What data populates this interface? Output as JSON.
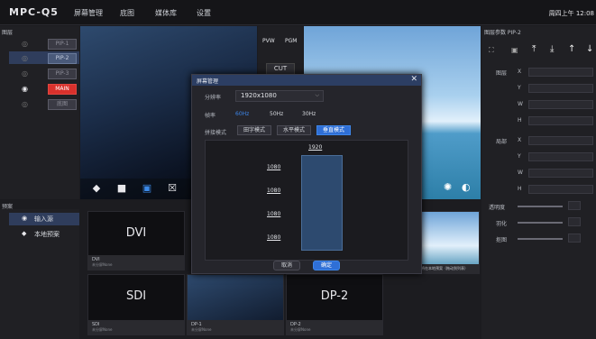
{
  "app": {
    "title": "MPC-Q5",
    "clock": "周四上午 12:08"
  },
  "menu": [
    "屏幕管理",
    "底图",
    "媒体库",
    "设置"
  ],
  "layers": {
    "title": "图层",
    "items": [
      "PIP-1",
      "PIP-2",
      "PIP-3",
      "MAIN",
      "底图"
    ]
  },
  "preview": {
    "pvw": "PVW",
    "pgm": "PGM",
    "cut": "CUT"
  },
  "right": {
    "title": "图层参数 PIP-2",
    "layer_section": "图层",
    "local_section": "局部",
    "fields": [
      "X",
      "Y",
      "W",
      "H"
    ],
    "sliders": [
      "透明度",
      "羽化",
      "抠图"
    ]
  },
  "presets": {
    "title": "预案",
    "sources": [
      "输入源",
      "本地预案"
    ],
    "thumbs": [
      {
        "big": "DVI",
        "name": "DVI",
        "sub": "未分屏None"
      },
      {
        "big": "SDI",
        "name": "SDI",
        "sub": "未分屏None"
      },
      {
        "big": "",
        "name": "DP-1",
        "sub": "未分屏None"
      },
      {
        "big": "DP-2",
        "name": "DP-2",
        "sub": "未分屏None"
      }
    ],
    "hint": "将在本地预案（拖动到列表）"
  },
  "modal": {
    "title": "屏幕管理",
    "resolution_label": "分辨率",
    "resolution_value": "1920x1080",
    "rate_label": "帧率",
    "rates": [
      "60Hz",
      "50Hz",
      "30Hz"
    ],
    "splice_label": "拼接模式",
    "modes": [
      "田字模式",
      "水平模式",
      "垂直模式"
    ],
    "width_label": "1920",
    "row_labels": [
      "1080",
      "1080",
      "1080",
      "1080"
    ],
    "cancel": "取消",
    "confirm": "确定"
  },
  "colors": {
    "accent": "#2f6fd6",
    "main_tag": "#d9312c",
    "selection": "#2f3d5c"
  }
}
